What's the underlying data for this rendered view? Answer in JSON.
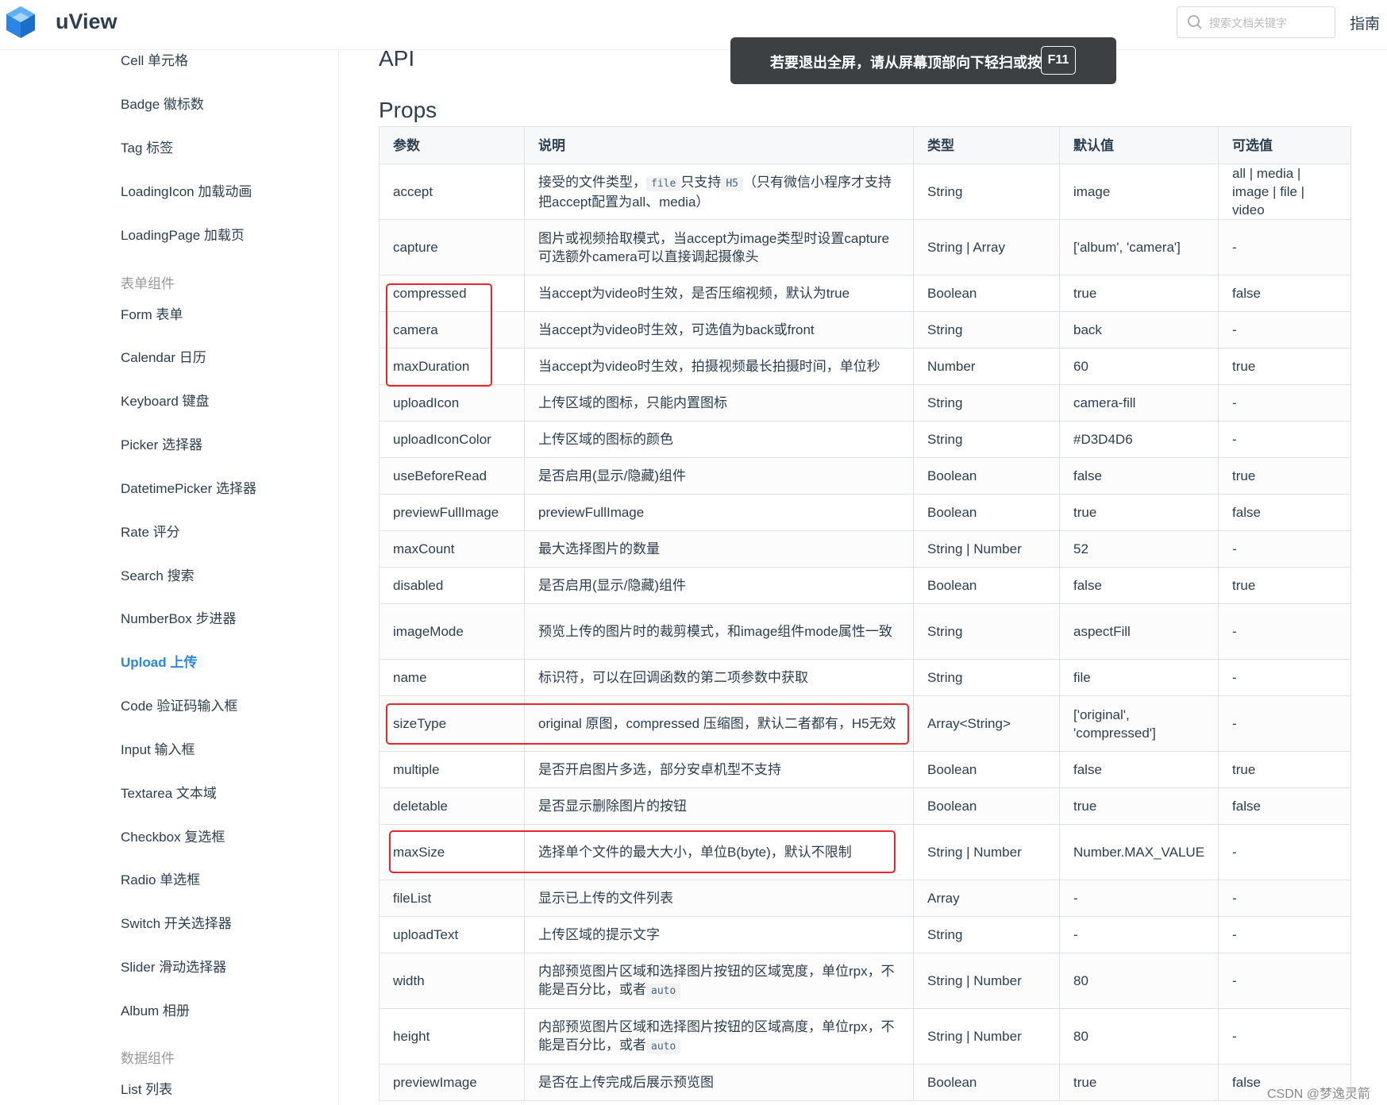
{
  "header": {
    "brand": "uView",
    "search_placeholder": "搜索文档关键字",
    "guide": "指南"
  },
  "toast": {
    "text": "若要退出全屏，请从屏幕顶部向下轻扫或按",
    "key": "F11"
  },
  "sidebar": {
    "items": [
      {
        "label": "Cell 单元格"
      },
      {
        "label": "Badge 徽标数"
      },
      {
        "label": "Tag 标签"
      },
      {
        "label": "LoadingIcon 加载动画"
      },
      {
        "label": "LoadingPage 加载页"
      },
      {
        "group": "表单组件"
      },
      {
        "label": "Form 表单"
      },
      {
        "label": "Calendar 日历"
      },
      {
        "label": "Keyboard 键盘"
      },
      {
        "label": "Picker 选择器"
      },
      {
        "label": "DatetimePicker 选择器"
      },
      {
        "label": "Rate 评分"
      },
      {
        "label": "Search 搜索"
      },
      {
        "label": "NumberBox 步进器"
      },
      {
        "label": "Upload 上传",
        "active": true
      },
      {
        "label": "Code 验证码输入框"
      },
      {
        "label": "Input 输入框"
      },
      {
        "label": "Textarea 文本域"
      },
      {
        "label": "Checkbox 复选框"
      },
      {
        "label": "Radio 单选框"
      },
      {
        "label": "Switch 开关选择器"
      },
      {
        "label": "Slider 滑动选择器"
      },
      {
        "label": "Album 相册"
      },
      {
        "group": "数据组件"
      },
      {
        "label": "List 列表"
      }
    ]
  },
  "main": {
    "api_heading": "API",
    "props_heading": "Props",
    "columns": [
      "参数",
      "说明",
      "类型",
      "默认值",
      "可选值"
    ],
    "rows": [
      {
        "name": "accept",
        "desc": [
          "接受的文件类型，",
          {
            "code": "file"
          },
          "只支持",
          {
            "code": "H5"
          },
          "（只有微信小程序才支持把accept配置为all、media）"
        ],
        "type": "String",
        "default": "image",
        "options": "all | media | image | file | video"
      },
      {
        "name": "capture",
        "desc": [
          "图片或视频拾取模式，当accept为image类型时设置capture可选额外camera可以直接调起摄像头"
        ],
        "type": "String | Array",
        "default": "['album', 'camera']",
        "options": "-"
      },
      {
        "name": "compressed",
        "desc": [
          "当accept为video时生效，是否压缩视频，默认为true"
        ],
        "type": "Boolean",
        "default": "true",
        "options": "false"
      },
      {
        "name": "camera",
        "desc": [
          "当accept为video时生效，可选值为back或front"
        ],
        "type": "String",
        "default": "back",
        "options": "-"
      },
      {
        "name": "maxDuration",
        "desc": [
          "当accept为video时生效，拍摄视频最长拍摄时间，单位秒"
        ],
        "type": "Number",
        "default": "60",
        "options": "true"
      },
      {
        "name": "uploadIcon",
        "desc": [
          "上传区域的图标，只能内置图标"
        ],
        "type": "String",
        "default": "camera-fill",
        "options": "-"
      },
      {
        "name": "uploadIconColor",
        "desc": [
          "上传区域的图标的颜色"
        ],
        "type": "String",
        "default": "#D3D4D6",
        "options": "-"
      },
      {
        "name": "useBeforeRead",
        "desc": [
          "是否启用(显示/隐藏)组件"
        ],
        "type": "Boolean",
        "default": "false",
        "options": "true"
      },
      {
        "name": "previewFullImage",
        "desc": [
          "previewFullImage"
        ],
        "type": "Boolean",
        "default": "true",
        "options": "false"
      },
      {
        "name": "maxCount",
        "desc": [
          "最大选择图片的数量"
        ],
        "type": "String | Number",
        "default": "52",
        "options": "-"
      },
      {
        "name": "disabled",
        "desc": [
          "是否启用(显示/隐藏)组件"
        ],
        "type": "Boolean",
        "default": "false",
        "options": "true"
      },
      {
        "name": "imageMode",
        "desc": [
          "预览上传的图片时的裁剪模式，和image组件mode属性一致"
        ],
        "type": "String",
        "default": "aspectFill",
        "options": "-"
      },
      {
        "name": "name",
        "desc": [
          "标识符，可以在回调函数的第二项参数中获取"
        ],
        "type": "String",
        "default": "file",
        "options": "-"
      },
      {
        "name": "sizeType",
        "desc": [
          "original 原图，compressed 压缩图，默认二者都有，H5无效"
        ],
        "type": "Array<String>",
        "default": "['original', 'compressed']",
        "options": "-"
      },
      {
        "name": "multiple",
        "desc": [
          "是否开启图片多选，部分安卓机型不支持"
        ],
        "type": "Boolean",
        "default": "false",
        "options": "true"
      },
      {
        "name": "deletable",
        "desc": [
          "是否显示删除图片的按钮"
        ],
        "type": "Boolean",
        "default": "true",
        "options": "false"
      },
      {
        "name": "maxSize",
        "desc": [
          "选择单个文件的最大大小，单位B(byte)，默认不限制"
        ],
        "type": "String | Number",
        "default": "Number.MAX_VALUE",
        "options": "-"
      },
      {
        "name": "fileList",
        "desc": [
          "显示已上传的文件列表"
        ],
        "type": "Array",
        "default": "-",
        "options": "-"
      },
      {
        "name": "uploadText",
        "desc": [
          "上传区域的提示文字"
        ],
        "type": "String",
        "default": "-",
        "options": "-"
      },
      {
        "name": "width",
        "desc": [
          "内部预览图片区域和选择图片按钮的区域宽度，单位rpx，不能是百分比，或者",
          {
            "code": "auto"
          }
        ],
        "type": "String | Number",
        "default": "80",
        "options": "-"
      },
      {
        "name": "height",
        "desc": [
          "内部预览图片区域和选择图片按钮的区域高度，单位rpx，不能是百分比，或者",
          {
            "code": "auto"
          }
        ],
        "type": "String | Number",
        "default": "80",
        "options": "-"
      },
      {
        "name": "previewImage",
        "desc": [
          "是否在上传完成后展示预览图"
        ],
        "type": "Boolean",
        "default": "true",
        "options": "false"
      }
    ]
  },
  "watermark": "CSDN @梦逸灵箭",
  "colors": {
    "accent": "#2b85e4",
    "highlight": "#e8262b",
    "toast_bg": "#3d4043"
  }
}
